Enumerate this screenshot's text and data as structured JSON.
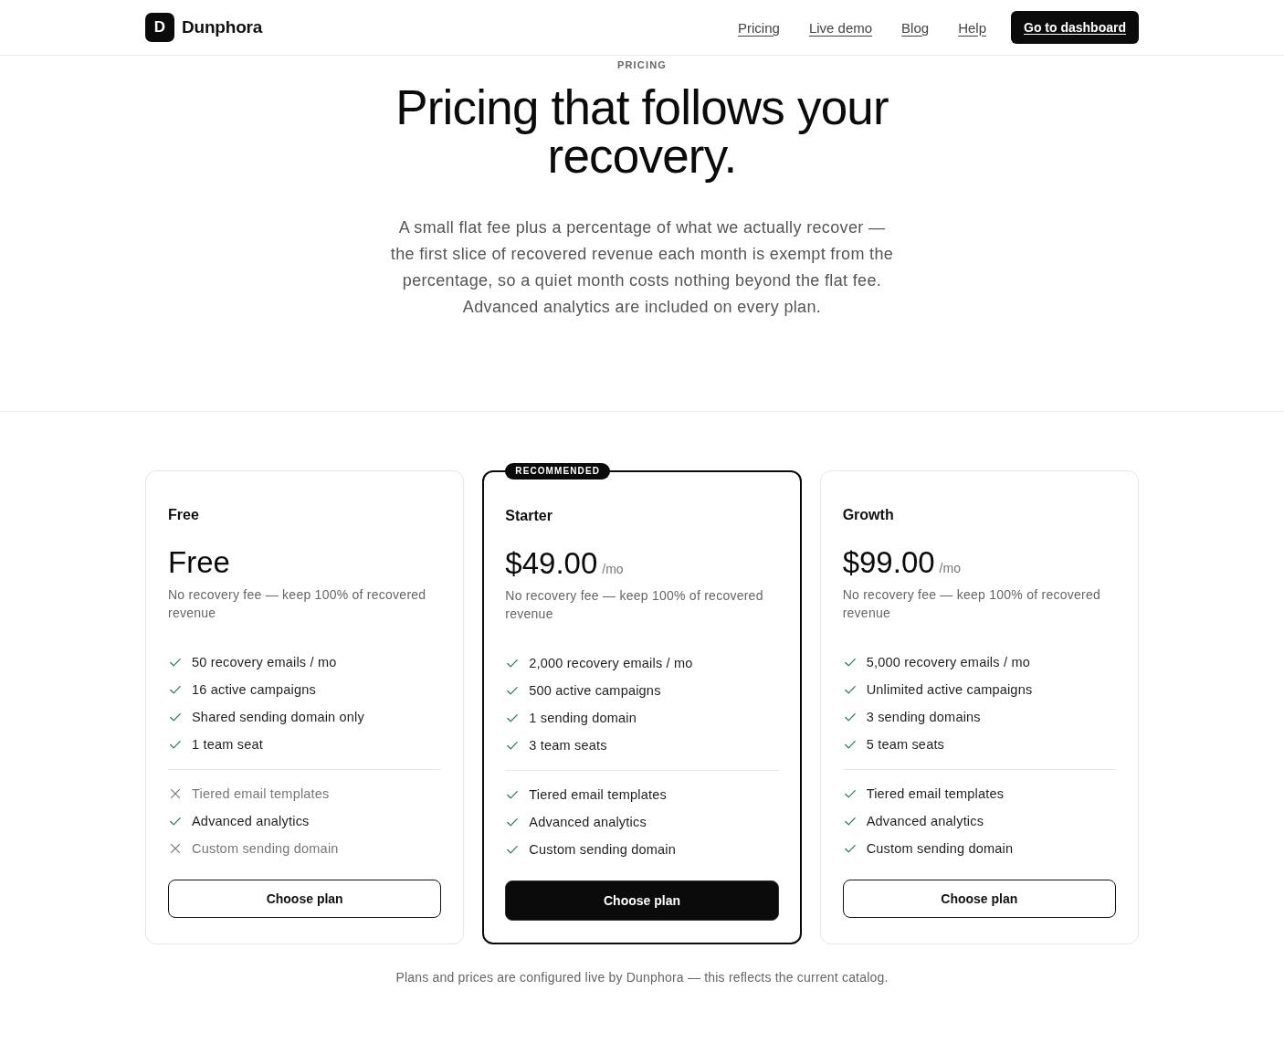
{
  "header": {
    "logo_letter": "D",
    "brand": "Dunphora",
    "nav": [
      {
        "label": "Pricing"
      },
      {
        "label": "Live demo"
      },
      {
        "label": "Blog"
      },
      {
        "label": "Help"
      }
    ],
    "cta": "Go to dashboard"
  },
  "hero": {
    "eyebrow": "PRICING",
    "title": "Pricing that follows your recovery.",
    "intro": "A small flat fee plus a percentage of what we actually recover — the first slice of recovered revenue each month is exempt from the percentage, so a quiet month costs nothing beyond the flat fee. Advanced analytics are included on every plan."
  },
  "plans": [
    {
      "name": "Free",
      "recommended": false,
      "price": "Free",
      "description": "No recovery fee — keep 100% of recovered revenue",
      "limits": [
        {
          "label": "50 recovery emails / mo",
          "included": true
        },
        {
          "label": "16 active campaigns",
          "included": true
        },
        {
          "label": "Shared sending domain only",
          "included": true
        },
        {
          "label": "1 team seat",
          "included": true
        }
      ],
      "extras": [
        {
          "label": "Tiered email templates",
          "included": false
        },
        {
          "label": "Advanced analytics",
          "included": true
        },
        {
          "label": "Custom sending domain",
          "included": false
        }
      ],
      "button": "Choose plan"
    },
    {
      "name": "Starter",
      "recommended": true,
      "badge": "RECOMMENDED",
      "price": "$49.00",
      "period": "/mo",
      "description": "No recovery fee — keep 100% of recovered revenue",
      "limits": [
        {
          "label": "2,000 recovery emails / mo",
          "included": true
        },
        {
          "label": "500 active campaigns",
          "included": true
        },
        {
          "label": "1 sending domain",
          "included": true
        },
        {
          "label": "3 team seats",
          "included": true
        }
      ],
      "extras": [
        {
          "label": "Tiered email templates",
          "included": true
        },
        {
          "label": "Advanced analytics",
          "included": true
        },
        {
          "label": "Custom sending domain",
          "included": true
        }
      ],
      "button": "Choose plan"
    },
    {
      "name": "Growth",
      "recommended": false,
      "price": "$99.00",
      "period": "/mo",
      "description": "No recovery fee — keep 100% of recovered revenue",
      "limits": [
        {
          "label": "5,000 recovery emails / mo",
          "included": true
        },
        {
          "label": "Unlimited active campaigns",
          "included": true
        },
        {
          "label": "3 sending domains",
          "included": true
        },
        {
          "label": "5 team seats",
          "included": true
        }
      ],
      "extras": [
        {
          "label": "Tiered email templates",
          "included": true
        },
        {
          "label": "Advanced analytics",
          "included": true
        },
        {
          "label": "Custom sending domain",
          "included": true
        }
      ],
      "button": "Choose plan"
    }
  ],
  "footer_note": "Plans and prices are configured live by Dunphora — this reflects the current catalog."
}
